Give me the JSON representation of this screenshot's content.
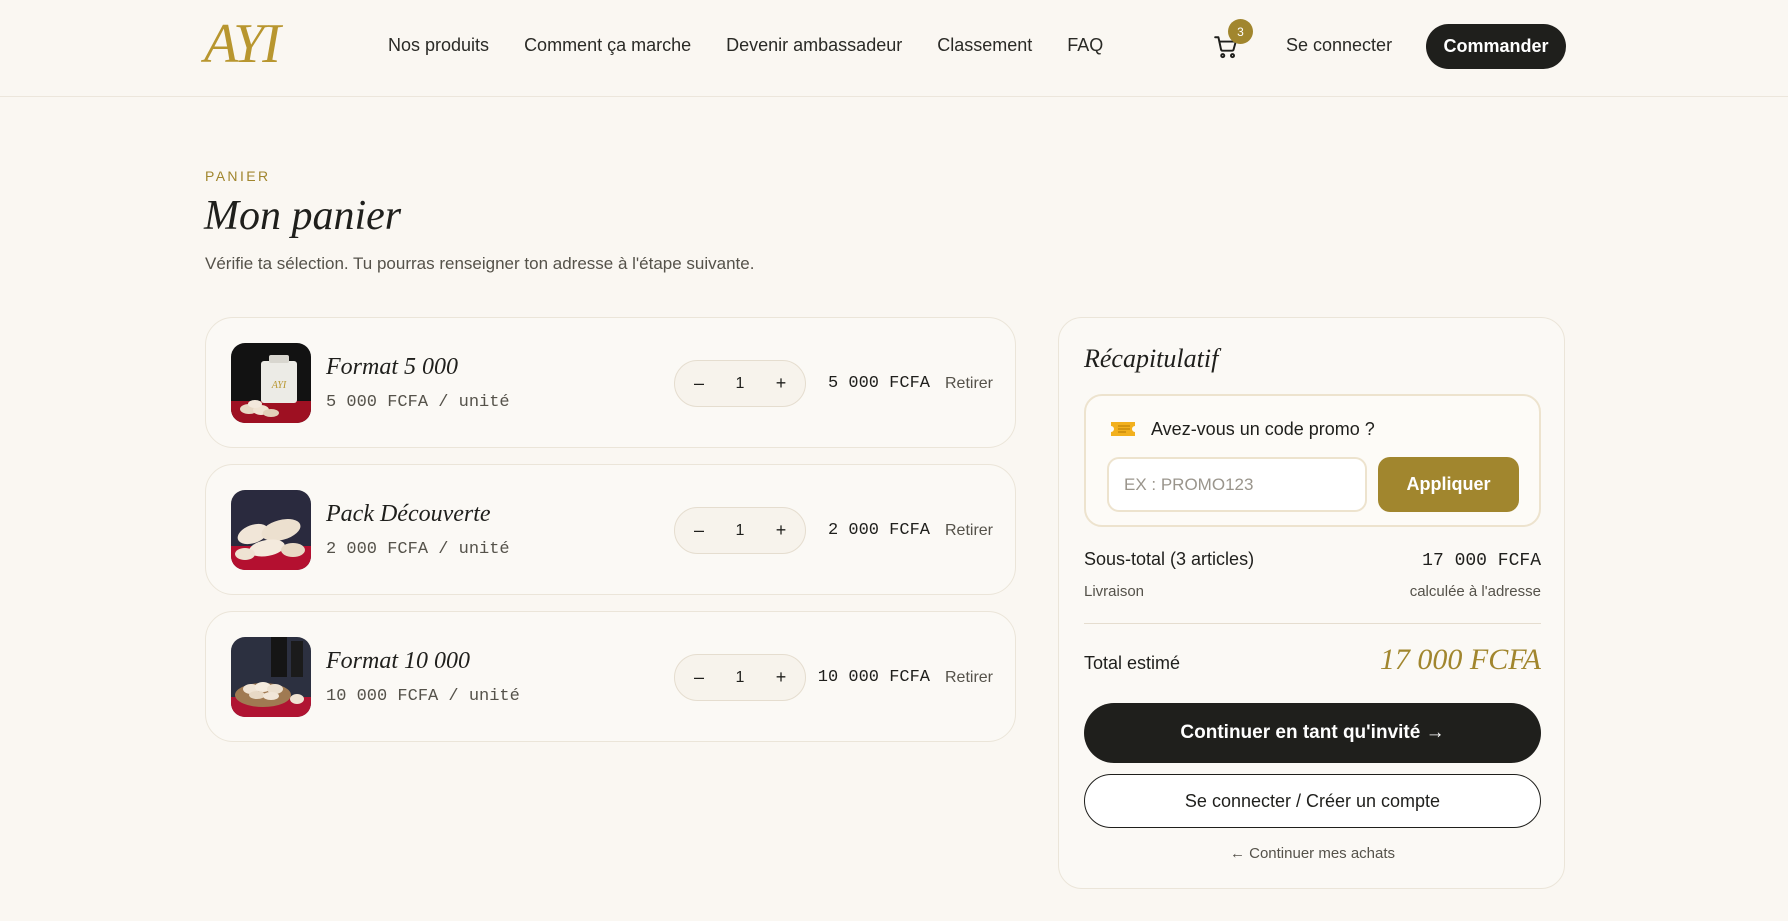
{
  "header": {
    "logo": "AYI",
    "nav": [
      "Nos produits",
      "Comment ça marche",
      "Devenir ambassadeur",
      "Classement",
      "FAQ"
    ],
    "cart_count": "3",
    "login_label": "Se connecter",
    "order_label": "Commander"
  },
  "page": {
    "eyebrow": "PANIER",
    "title": "Mon panier",
    "subtitle": "Vérifie ta sélection. Tu pourras renseigner ton adresse à l'étape suivante."
  },
  "items": [
    {
      "name": "Format 5 000",
      "unit_price": "5 000 FCFA / unité",
      "qty": "1",
      "price": "5 000 FCFA",
      "remove": "Retirer",
      "minus": "–",
      "plus": "+"
    },
    {
      "name": "Pack Découverte",
      "unit_price": "2 000 FCFA / unité",
      "qty": "1",
      "price": "2 000 FCFA",
      "remove": "Retirer",
      "minus": "–",
      "plus": "+"
    },
    {
      "name": "Format 10 000",
      "unit_price": "10 000 FCFA / unité",
      "qty": "1",
      "price": "10 000 FCFA",
      "remove": "Retirer",
      "minus": "–",
      "plus": "+"
    }
  ],
  "summary": {
    "title": "Récapitulatif",
    "promo_label": "Avez-vous un code promo ?",
    "promo_placeholder": "EX : PROMO123",
    "apply_label": "Appliquer",
    "subtotal_label": "Sous-total (3 articles)",
    "subtotal_value": "17 000 FCFA",
    "delivery_label": "Livraison",
    "delivery_value": "calculée à l'adresse",
    "total_label": "Total estimé",
    "total_value": "17 000 FCFA",
    "guest_label": "Continuer en tant qu'invité →",
    "account_label": "Se connecter / Créer un compte",
    "continue_label": "← Continuer mes achats"
  },
  "colors": {
    "accent": "#a1862e",
    "logo": "#b8962f",
    "dark": "#1f1f1c",
    "background": "#faf7f2"
  },
  "icons": {
    "cart": "cart-icon",
    "promo": "ticket-icon"
  }
}
